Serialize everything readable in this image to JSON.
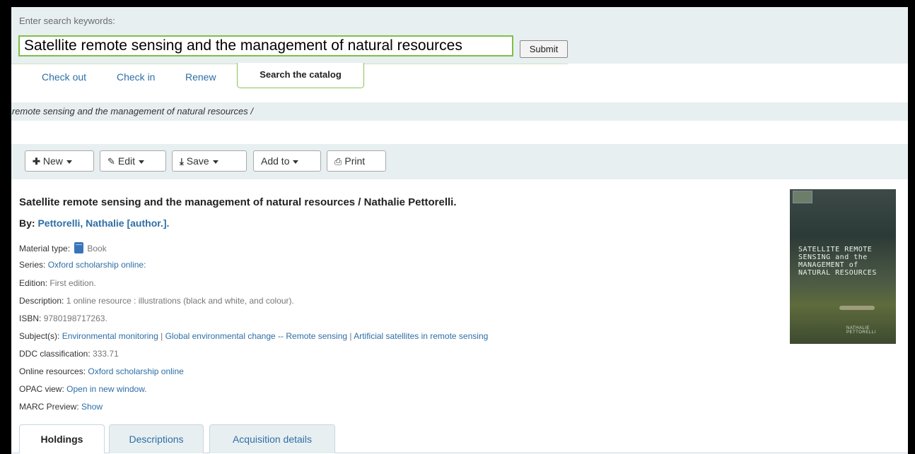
{
  "search": {
    "label": "Enter search keywords:",
    "value": "Satellite remote sensing and the management of natural resources",
    "submit_label": "Submit"
  },
  "nav_tabs": {
    "check_out": "Check out",
    "check_in": "Check in",
    "renew": "Renew",
    "search_catalog": "Search the catalog"
  },
  "breadcrumb": {
    "text": "e remote sensing and the management of natural resources /"
  },
  "toolbar": {
    "new": "New",
    "edit": "Edit",
    "save": "Save",
    "add_to": "Add to",
    "print": "Print"
  },
  "record": {
    "title": "Satellite remote sensing and the management of natural resources / Nathalie Pettorelli.",
    "by_label": "By:",
    "author": "Pettorelli, Nathalie [author.].",
    "material_type_label": "Material type:",
    "material_type": "Book",
    "series_label": "Series:",
    "series": "Oxford scholarship online:",
    "edition_label": "Edition:",
    "edition": "First edition.",
    "description_label": "Description:",
    "description": "1 online resource : illustrations (black and white, and colour).",
    "isbn_label": "ISBN:",
    "isbn": "9780198717263.",
    "subjects_label": "Subject(s):",
    "subject_1": "Environmental monitoring",
    "subject_sep_1": "|",
    "subject_2": "Global environmental change -- Remote sensing",
    "subject_sep_2": "|",
    "subject_3": "Artificial satellites in remote sensing",
    "ddc_label": "DDC classification:",
    "ddc": "333.71",
    "online_label": "Online resources:",
    "online": "Oxford scholarship online",
    "opac_label": "OPAC view:",
    "opac": "Open in new window.",
    "marc_label": "MARC Preview:",
    "marc": "Show"
  },
  "cover": {
    "title_line_1": "SATELLITE REMOTE",
    "title_line_2": "SENSING and the",
    "title_line_3": "MANAGEMENT of",
    "title_line_4": "NATURAL RESOURCES",
    "author": "NATHALIE PETTORELLI"
  },
  "detail_tabs": {
    "holdings": "Holdings",
    "descriptions": "Descriptions",
    "acquisition": "Acquisition details"
  },
  "colors": {
    "link": "#2e6ea6",
    "panel_bg": "#e8eff1",
    "focus_green": "#7fbf45"
  }
}
